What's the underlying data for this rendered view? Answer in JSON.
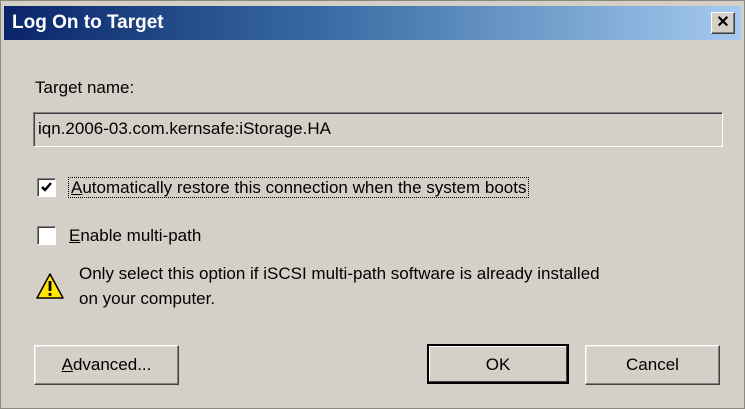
{
  "window": {
    "title": "Log On to Target",
    "close_glyph": "✕"
  },
  "target": {
    "label": "Target name:",
    "value": "iqn.2006-03.com.kernsafe:iStorage.HA"
  },
  "options": {
    "auto_restore": {
      "mnemonic": "A",
      "rest": "utomatically restore this connection when the system boots",
      "checked": true
    },
    "multipath": {
      "mnemonic": "E",
      "rest": "nable multi-path",
      "checked": false
    }
  },
  "warning": {
    "icon": "warning-icon",
    "line1": "Only select this option if iSCSI multi-path software is already installed",
    "line2": "on your computer."
  },
  "buttons": {
    "advanced": {
      "mnemonic": "A",
      "rest": "dvanced..."
    },
    "ok": "OK",
    "cancel": "Cancel"
  }
}
